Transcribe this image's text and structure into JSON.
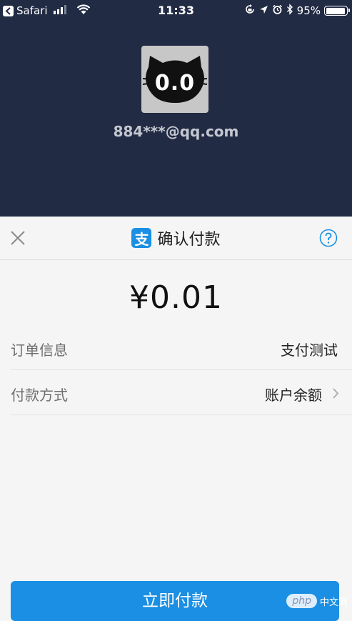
{
  "status_bar": {
    "back_app": "Safari",
    "time": "11:33",
    "battery": "95%",
    "battery_level": 0.95,
    "icons": [
      "signal-icon",
      "wifi-icon",
      "screen-lock-icon",
      "location-icon",
      "alarm-icon",
      "bluetooth-icon"
    ]
  },
  "merchant": {
    "avatar_icon": "cat-face-icon",
    "avatar_text": "0.0",
    "account": "884***@qq.com"
  },
  "sheet": {
    "title": "确认付款",
    "logo_char": "支",
    "close_icon": "close-icon",
    "help_icon": "question-icon",
    "amount": "¥0.01",
    "rows": [
      {
        "label": "订单信息",
        "value": "支付测试"
      },
      {
        "label": "付款方式",
        "value": "账户余额"
      }
    ],
    "pay_button": "立即付款"
  },
  "watermark": {
    "logo": "php",
    "text": "中文网"
  },
  "colors": {
    "header_bg": "#222b44",
    "sheet_bg": "#f5f5f5",
    "accent": "#1a8fe4"
  }
}
